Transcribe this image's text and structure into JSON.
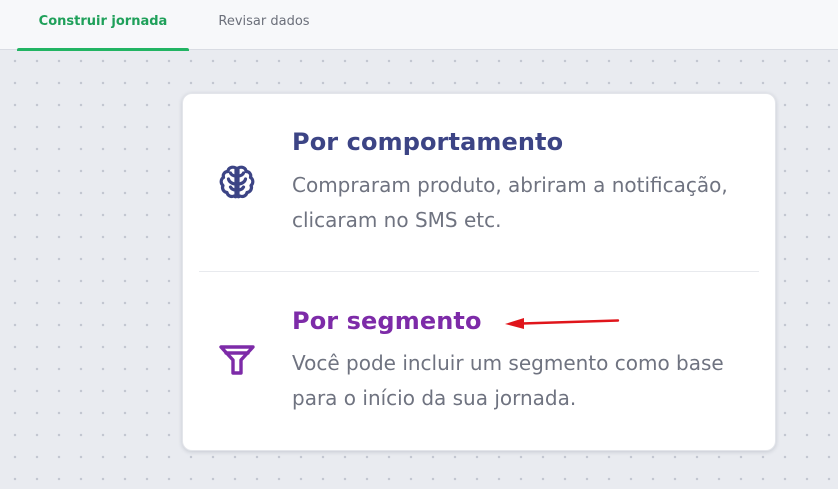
{
  "tabs": [
    {
      "label": "Construir jornada",
      "active": true
    },
    {
      "label": "Revisar dados",
      "active": false
    }
  ],
  "options": [
    {
      "title": "Por comportamento",
      "description": "Compraram produto, abriram a notificação, clicaram no SMS etc.",
      "icon": "brain-icon"
    },
    {
      "title": "Por segmento",
      "description": "Você pode incluir um segmento como base para o início da sua jornada.",
      "icon": "funnel-icon"
    }
  ],
  "colors": {
    "tab_active": "#1fa05a",
    "option_1_title": "#3c4485",
    "option_2_title": "#7d2ba8",
    "annotation_arrow": "#e0151b"
  }
}
